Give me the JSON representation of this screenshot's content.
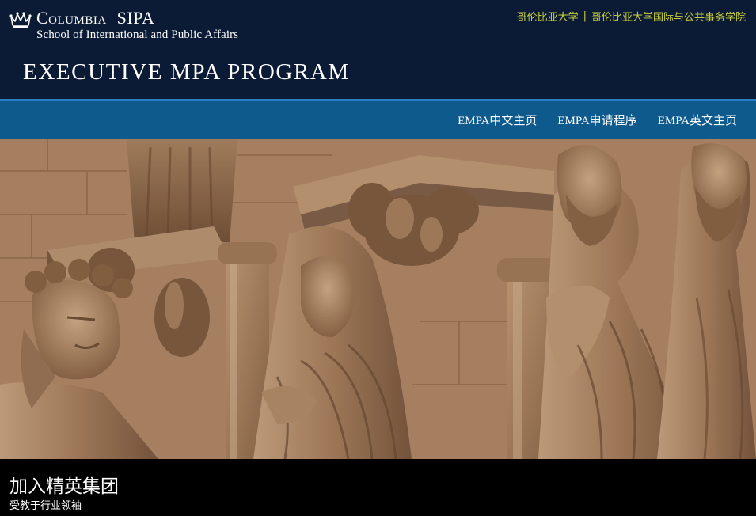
{
  "header": {
    "logo_main_left": "Columbia",
    "logo_main_right": "SIPA",
    "logo_sub": "School of International and Public Affairs",
    "program_title": "EXECUTIVE MPA PROGRAM",
    "top_links": [
      {
        "label": "哥伦比亚大学"
      },
      {
        "label": "哥伦比亚大学国际与公共事务学院"
      }
    ],
    "top_links_divider": "|"
  },
  "nav": {
    "items": [
      {
        "label": "EMPA中文主页"
      },
      {
        "label": "EMPA申请程序"
      },
      {
        "label": "EMPA英文主页"
      }
    ]
  },
  "hero": {
    "image_subject": "cathedral-statues"
  },
  "caption": {
    "title": "加入精英集团",
    "subtitle": "受教于行业领袖"
  },
  "colors": {
    "header_bg": "#0c1b35",
    "nav_bg": "#0f5a8d",
    "top_link": "#c8cf3a",
    "caption_bg": "#000000"
  }
}
